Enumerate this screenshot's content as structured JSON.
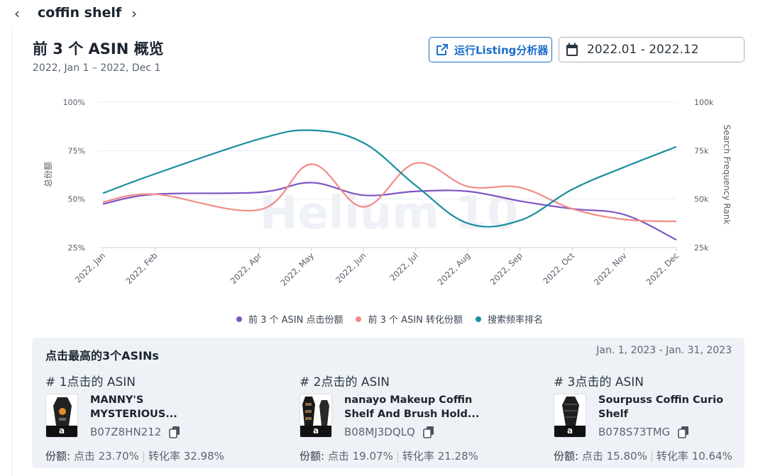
{
  "header": {
    "keyword": "coffin shelf"
  },
  "overview": {
    "title": "前 3 个 ASIN 概览",
    "subtitle": "2022, Jan 1 – 2022, Dec 1",
    "listing_button": "运行Listing分析器",
    "date_range": "2022.01 - 2022.12"
  },
  "chart_data": {
    "type": "line",
    "categories": [
      "2022, Jan",
      "2022, Feb",
      "2022, Apr",
      "2022, May",
      "2022, Jun",
      "2022, Jul",
      "2022, Aug",
      "2022, Sep",
      "2022, Oct",
      "2022, Nov",
      "2022, Dec"
    ],
    "x": [
      0,
      1,
      3,
      4,
      5,
      6,
      7,
      8,
      9,
      10,
      11
    ],
    "ylabel": "总份额",
    "y2label": "Search Frequency Rank",
    "yticks": [
      "100%",
      "75%",
      "50%",
      "25%"
    ],
    "y2ticks": [
      "100k",
      "75k",
      "50k",
      "25k"
    ],
    "ylim": [
      25,
      100
    ],
    "y2lim": [
      25000,
      100000
    ],
    "watermark": "Helium 10",
    "legend_position": "bottom",
    "series": [
      {
        "name": "前 3 个 ASIN 点击份额",
        "axis": "left",
        "color": "#7e57c2",
        "values": [
          47.5,
          52.5,
          53.5,
          58.5,
          52,
          54,
          54,
          49,
          45,
          42,
          29
        ]
      },
      {
        "name": "前 3 个 ASIN 转化份额",
        "axis": "left",
        "color": "#f28b88",
        "values": [
          48.5,
          52.5,
          44.5,
          68,
          46,
          68.5,
          56.5,
          56,
          45,
          39.5,
          38.5
        ]
      },
      {
        "name": "搜索频率排名",
        "axis": "right",
        "color": "#1b8ea0",
        "values": [
          53000,
          63000,
          81000,
          85500,
          79000,
          57000,
          37500,
          39000,
          55000,
          66500,
          77000
        ]
      }
    ]
  },
  "top_asins": {
    "title": "点击最高的3个ASINs",
    "date_range": "Jan. 1, 2023 - Jan. 31, 2023",
    "share_label": "份额:",
    "click_label": "点击",
    "conv_label": "转化率",
    "items": [
      {
        "rank": "# 1点击的 ASIN",
        "name_line1": "MANNY'S",
        "name_line2": "MYSTERIOUS...",
        "asin": "B07Z8HN212",
        "click": "23.70%",
        "conversion": "32.98%",
        "amazon": "a"
      },
      {
        "rank": "# 2点击的 ASIN",
        "name_line1": "nanayo Makeup Coffin",
        "name_line2": "Shelf And Brush Hold...",
        "asin": "B08MJ3DQLQ",
        "click": "19.07%",
        "conversion": "21.28%",
        "amazon": "a"
      },
      {
        "rank": "# 3点击的 ASIN",
        "name_line1": "Sourpuss Coffin Curio",
        "name_line2": "Shelf",
        "asin": "B078S73TMG",
        "click": "15.80%",
        "conversion": "10.64%",
        "amazon": "a"
      }
    ]
  }
}
